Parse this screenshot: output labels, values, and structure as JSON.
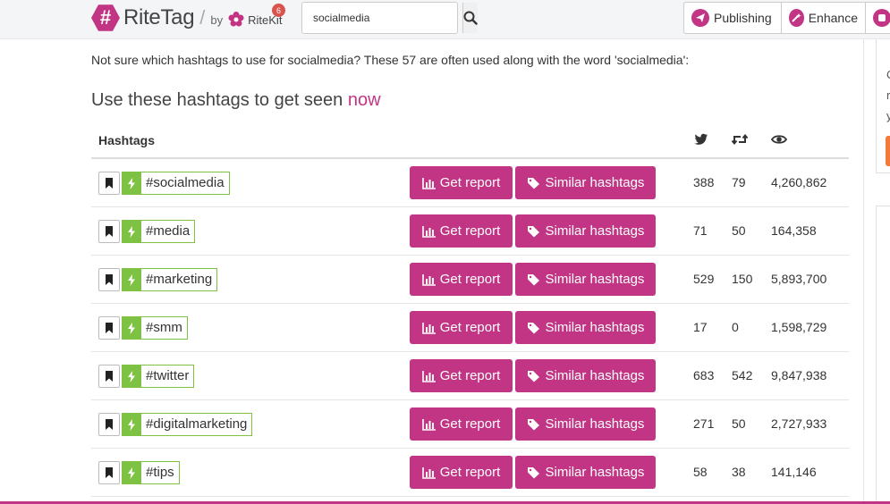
{
  "header": {
    "logo_glyph": "#",
    "logo_name": "RiteTag",
    "slash": "/",
    "by": "by",
    "ritekit_name": "RiteKit",
    "notification_count": "6",
    "search_value": "socialmedia",
    "nav": {
      "publishing": "Publishing",
      "enhance": "Enhance"
    }
  },
  "side": {
    "letters": [
      "C",
      "r",
      "y"
    ]
  },
  "content": {
    "intro": "Not sure which hashtags to use for socialmedia? These 57 are often used along with the word 'socialmedia':",
    "heading_main": "Use these hashtags to get seen ",
    "heading_accent": "now",
    "columns": {
      "hashtags": "Hashtags"
    },
    "rows": [
      {
        "tag": "#socialmedia",
        "report": "Get report",
        "similar": "Similar hashtags",
        "tweets": "388",
        "retweets": "79",
        "views": "4,260,862"
      },
      {
        "tag": "#media",
        "report": "Get report",
        "similar": "Similar hashtags",
        "tweets": "71",
        "retweets": "50",
        "views": "164,358"
      },
      {
        "tag": "#marketing",
        "report": "Get report",
        "similar": "Similar hashtags",
        "tweets": "529",
        "retweets": "150",
        "views": "5,893,700"
      },
      {
        "tag": "#smm",
        "report": "Get report",
        "similar": "Similar hashtags",
        "tweets": "17",
        "retweets": "0",
        "views": "1,598,729"
      },
      {
        "tag": "#twitter",
        "report": "Get report",
        "similar": "Similar hashtags",
        "tweets": "683",
        "retweets": "542",
        "views": "9,847,938"
      },
      {
        "tag": "#digitalmarketing",
        "report": "Get report",
        "similar": "Similar hashtags",
        "tweets": "271",
        "retweets": "50",
        "views": "2,727,933"
      },
      {
        "tag": "#tips",
        "report": "Get report",
        "similar": "Similar hashtags",
        "tweets": "58",
        "retweets": "38",
        "views": "141,146"
      }
    ]
  },
  "colors": {
    "brand": "#c13584",
    "tag_green": "#7dc242",
    "badge_red": "#d9534f"
  },
  "icons": [
    "search-icon",
    "twitter-icon",
    "retweet-icon",
    "eye-icon",
    "bookmark-icon",
    "bolt-icon",
    "bar-chart-icon",
    "tag-icon",
    "send-icon",
    "magic-icon"
  ]
}
